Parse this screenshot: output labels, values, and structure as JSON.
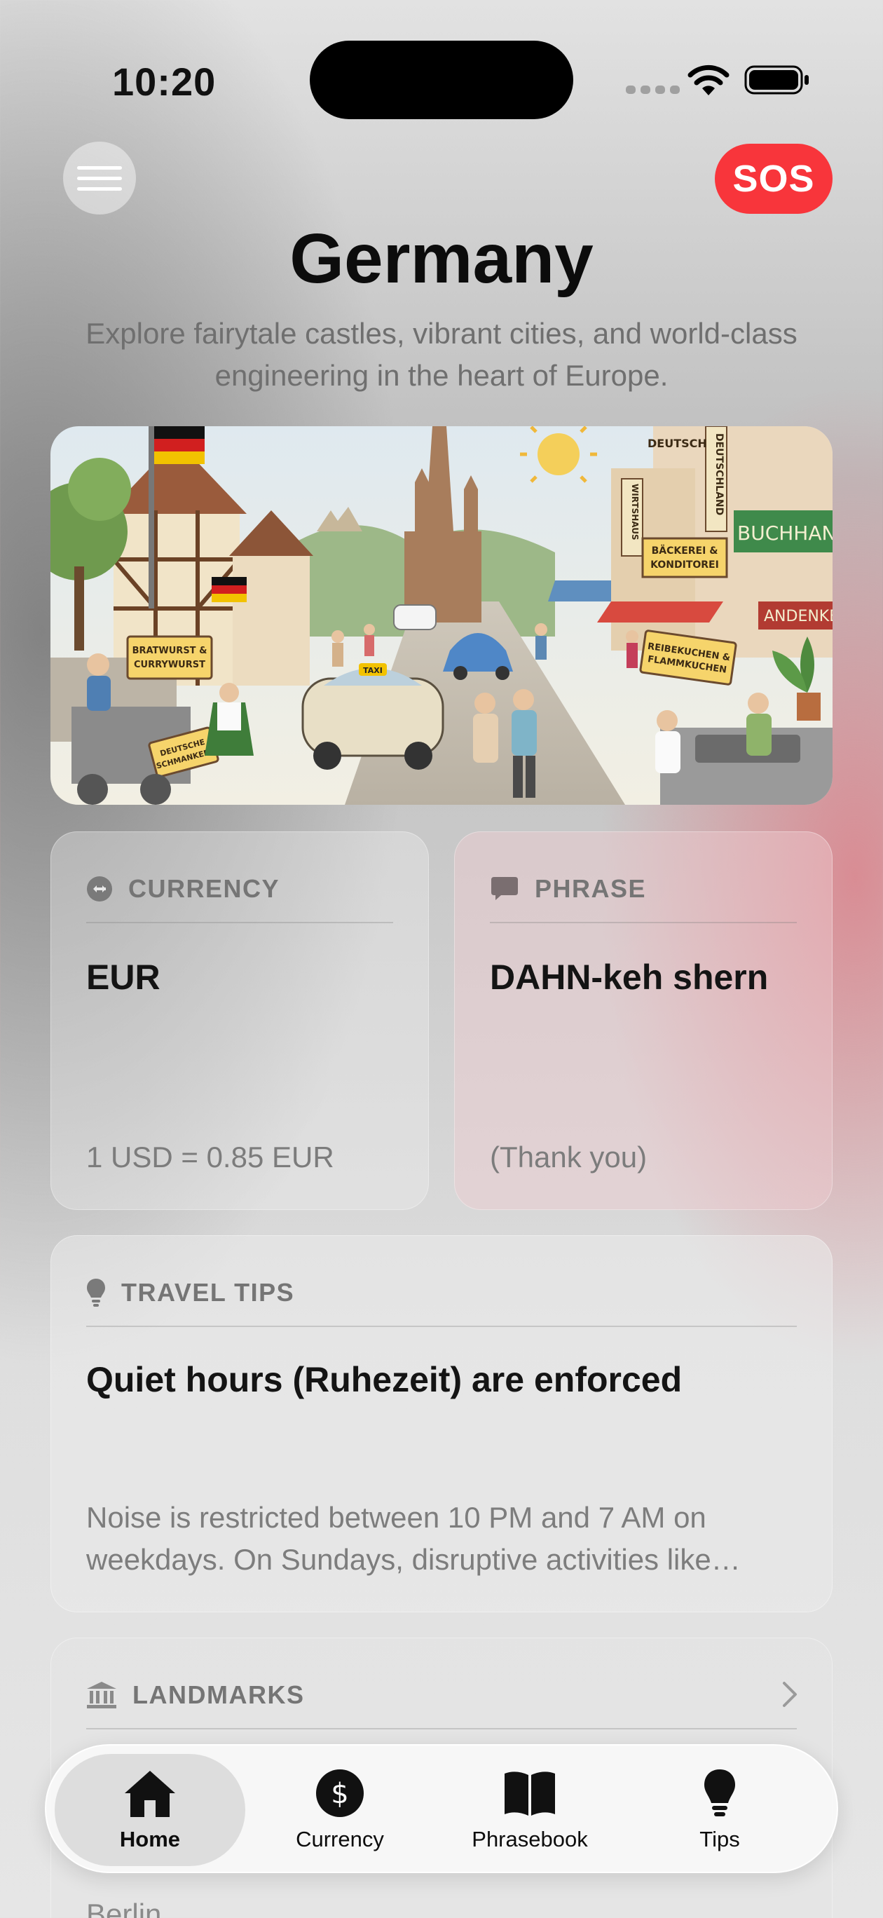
{
  "status_bar": {
    "time": "10:20"
  },
  "header": {
    "sos_label": "SOS"
  },
  "page": {
    "title": "Germany",
    "subtitle": "Explore fairytale castles, vibrant cities, and world-class engineering in the heart of Europe."
  },
  "hero": {
    "signs": {
      "deutschland": "DEUTSCHLAND",
      "wirtshaus": "WIRTSHAUS",
      "baeckerei": "BÄCKEREI & KONDITOREI",
      "buchhandlung": "BUCHHANDLUNG",
      "andenken": "ANDENKEN",
      "bratwurst": "BRATWURST & CURRYWURST",
      "schmankerl": "DEUTSCHE SCHMANKERL",
      "reibekuchen": "REIBEKUCHEN & FLAMMKUCHEN",
      "taxi": "TAXI"
    }
  },
  "currency_card": {
    "label": "CURRENCY",
    "value": "EUR",
    "rate": "1 USD = 0.85 EUR"
  },
  "phrase_card": {
    "label": "PHRASE",
    "value": "DAHN-keh shern",
    "translation": "(Thank you)"
  },
  "tips_card": {
    "label": "TRAVEL TIPS",
    "title": "Quiet hours (Ruhezeit) are enforced",
    "body": "Noise is restricted between 10 PM and 7 AM on weekdays. On Sundays, disruptive activities like mowing lawns or drilling are not allowed."
  },
  "landmarks_card": {
    "label": "LANDMARKS",
    "city": "Berlin"
  },
  "tab_bar": {
    "tabs": [
      {
        "label": "Home",
        "icon": "house-icon",
        "active": true
      },
      {
        "label": "Currency",
        "icon": "dollar-circle-icon",
        "active": false
      },
      {
        "label": "Phrasebook",
        "icon": "book-icon",
        "active": false
      },
      {
        "label": "Tips",
        "icon": "lightbulb-icon",
        "active": false
      }
    ]
  },
  "colors": {
    "sos": "#f8353b",
    "phrase_tint": "#f0cdd0",
    "text_primary": "#0c0c0c",
    "text_secondary": "#757575"
  }
}
